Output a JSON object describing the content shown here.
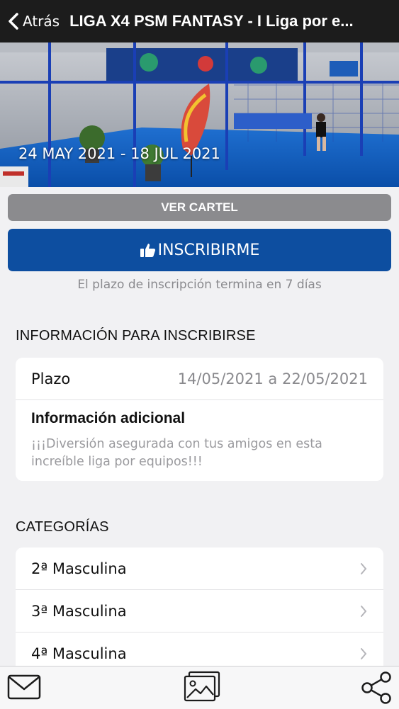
{
  "header": {
    "back_label": "Atrás",
    "title": "LIGA X4 PSM FANTASY - I Liga por e..."
  },
  "hero": {
    "date_range": "24 MAY 2021 - 18 JUL 2021"
  },
  "actions": {
    "cartel_label": "VER CARTEL",
    "inscribir_label": "INSCRIBIRME",
    "plazo_note": "El plazo de inscripción termina en 7 días"
  },
  "info": {
    "section_title": "INFORMACIÓN PARA INSCRIBIRSE",
    "plazo_label": "Plazo",
    "plazo_value": "14/05/2021 a 22/05/2021",
    "additional_title": "Información adicional",
    "additional_text": "¡¡¡Diversión asegurada con tus amigos en esta increíble liga por equipos!!!"
  },
  "categories": {
    "section_title": "CATEGORÍAS",
    "items": [
      {
        "label": "2ª Masculina"
      },
      {
        "label": "3ª Masculina"
      },
      {
        "label": "4ª Masculina"
      }
    ]
  },
  "bottom_bar": {
    "icons": [
      "mail-icon",
      "gallery-icon",
      "share-icon"
    ]
  },
  "colors": {
    "header_bg": "#1c1c1c",
    "primary_blue": "#0d4ea0",
    "secondary_gray": "#8b8b8e",
    "page_bg": "#f1f1f3"
  }
}
